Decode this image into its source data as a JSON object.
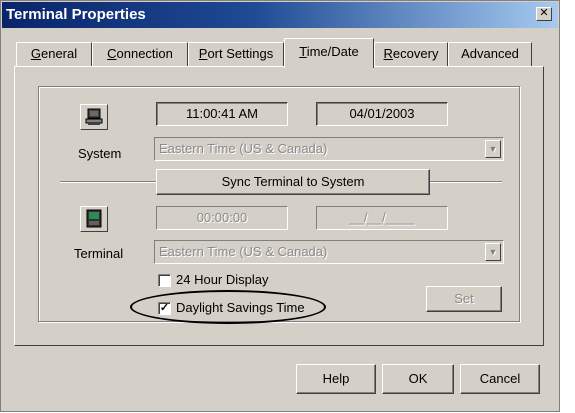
{
  "window": {
    "title": "Terminal Properties",
    "close_icon": "close-icon"
  },
  "tabs": [
    {
      "label": "General",
      "underline": "G",
      "rest": "eneral"
    },
    {
      "label": "Connection",
      "underline": "C",
      "rest": "onnection"
    },
    {
      "label": "Port Settings",
      "underline": "P",
      "rest": "ort Settings"
    },
    {
      "label": "Time/Date",
      "underline": "T",
      "rest": "ime/Date",
      "active": true
    },
    {
      "label": "Recovery",
      "underline": "R",
      "rest": "ecovery"
    },
    {
      "label": "Advanced",
      "underline": "",
      "rest": "Advanced"
    }
  ],
  "system": {
    "label": "System",
    "icon": "computer-icon",
    "time": "11:00:41 AM",
    "date": "04/01/2003",
    "timezone": "Eastern Time (US & Canada)"
  },
  "sync_button": "Sync Terminal to System",
  "terminal": {
    "label": "Terminal",
    "icon": "terminal-icon",
    "time": "00:00:00",
    "date": "__/__/____",
    "timezone": "Eastern Time (US & Canada)"
  },
  "options": {
    "hour24_label": "24 Hour Display",
    "hour24_checked": false,
    "dst_label": "Daylight Savings Time",
    "dst_checked": true
  },
  "set_button": "Set",
  "footer": {
    "help": "Help",
    "ok": "OK",
    "cancel": "Cancel"
  }
}
